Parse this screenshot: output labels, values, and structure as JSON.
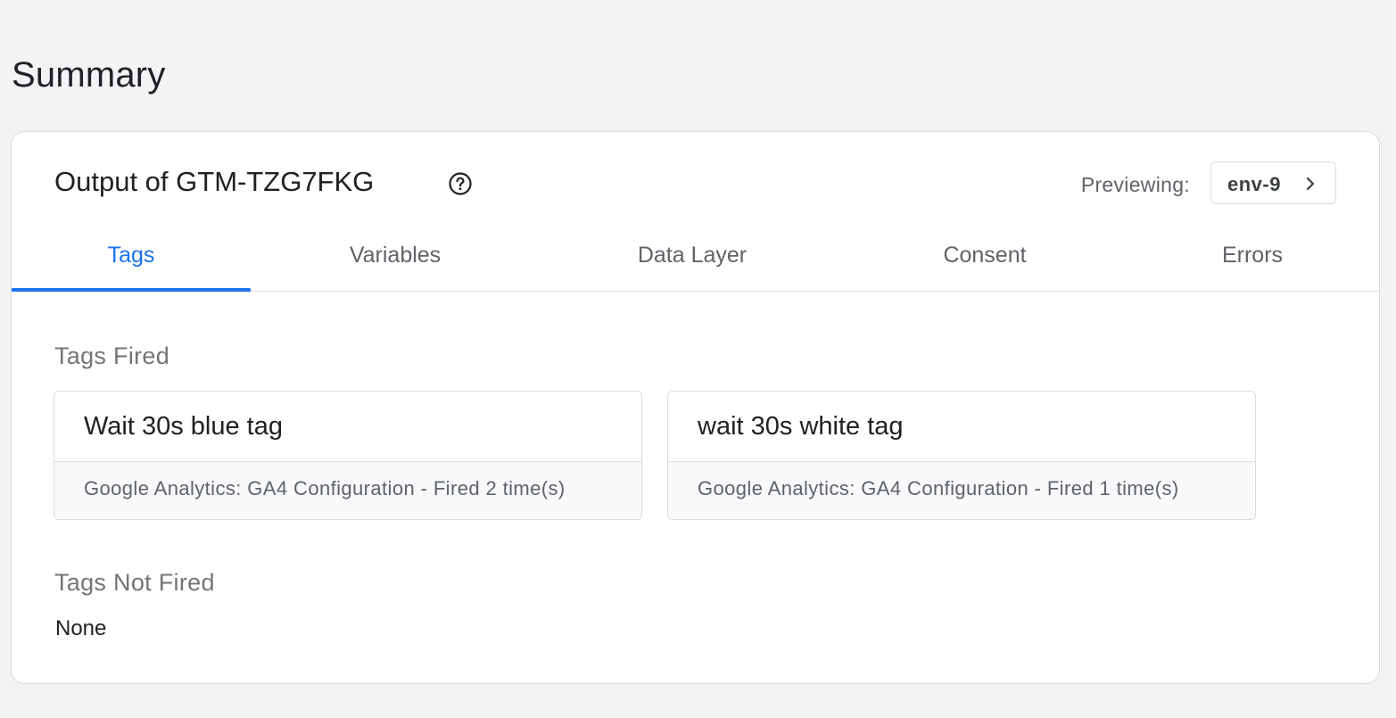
{
  "page": {
    "title": "Summary"
  },
  "card": {
    "title": "Output of GTM-TZG7FKG",
    "help_icon": "help-circle-icon",
    "previewing_label": "Previewing:",
    "env_value": "env-9",
    "env_icon": "chevron-right-icon"
  },
  "tabs": [
    {
      "label": "Tags",
      "active": true
    },
    {
      "label": "Variables",
      "active": false
    },
    {
      "label": "Data Layer",
      "active": false
    },
    {
      "label": "Consent",
      "active": false
    },
    {
      "label": "Errors",
      "active": false
    }
  ],
  "tags_fired": {
    "heading": "Tags Fired",
    "items": [
      {
        "name": "Wait 30s blue tag",
        "meta": "Google Analytics: GA4 Configuration - Fired 2 time(s)"
      },
      {
        "name": "wait 30s white tag",
        "meta": "Google Analytics: GA4 Configuration - Fired 1 time(s)"
      }
    ]
  },
  "tags_not_fired": {
    "heading": "Tags Not Fired",
    "value": "None"
  },
  "colors": {
    "accent": "#1a73e8",
    "background": "#f1f3f4",
    "border": "#dadce0"
  }
}
